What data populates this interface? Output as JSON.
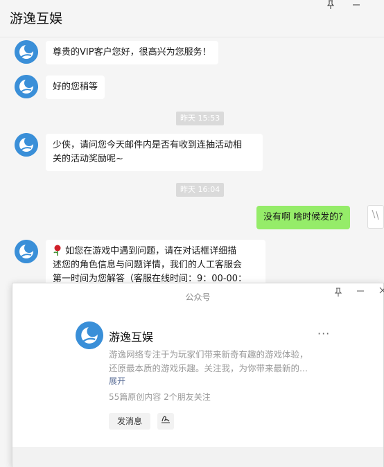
{
  "header": {
    "title": "游逸互娱"
  },
  "colors": {
    "avatar": "#3a8fd8",
    "my_bubble": "#95ec69",
    "link": "#576b95"
  },
  "messages": [
    {
      "from": "service",
      "text": "尊贵的VIP客户您好，很高兴为您服务！"
    },
    {
      "from": "service",
      "text": "好的您稍等"
    },
    {
      "type": "time",
      "text": "昨天  15:53"
    },
    {
      "from": "service",
      "lines": [
        "少侠，请问您今天邮件内是否有收到连抽活动相",
        "关的活动奖励呢~"
      ]
    },
    {
      "type": "time",
      "text": "昨天  16:04"
    },
    {
      "from": "me",
      "text": "没有啊 啥时候发的?"
    },
    {
      "from": "service",
      "icon": "rose-icon",
      "lines": [
        "如您在游戏中遇到问题，请在对话框详细描",
        "述您的角色信息与问题详情，我们的人工客服会",
        "第一时间为您解答（客服在线时间：9：00-00："
      ]
    }
  ],
  "popup": {
    "title": "公众号",
    "name": "游逸互娱",
    "more": "···",
    "desc_lines": [
      "游逸网络专注于为玩家们带来新奇有趣的游戏体验，",
      "还原最本质的游戏乐趣。关注我，为你带来最新的..."
    ],
    "expand": "展开",
    "stats": "55篇原创内容   2个朋友关注",
    "send_button": "发消息"
  }
}
